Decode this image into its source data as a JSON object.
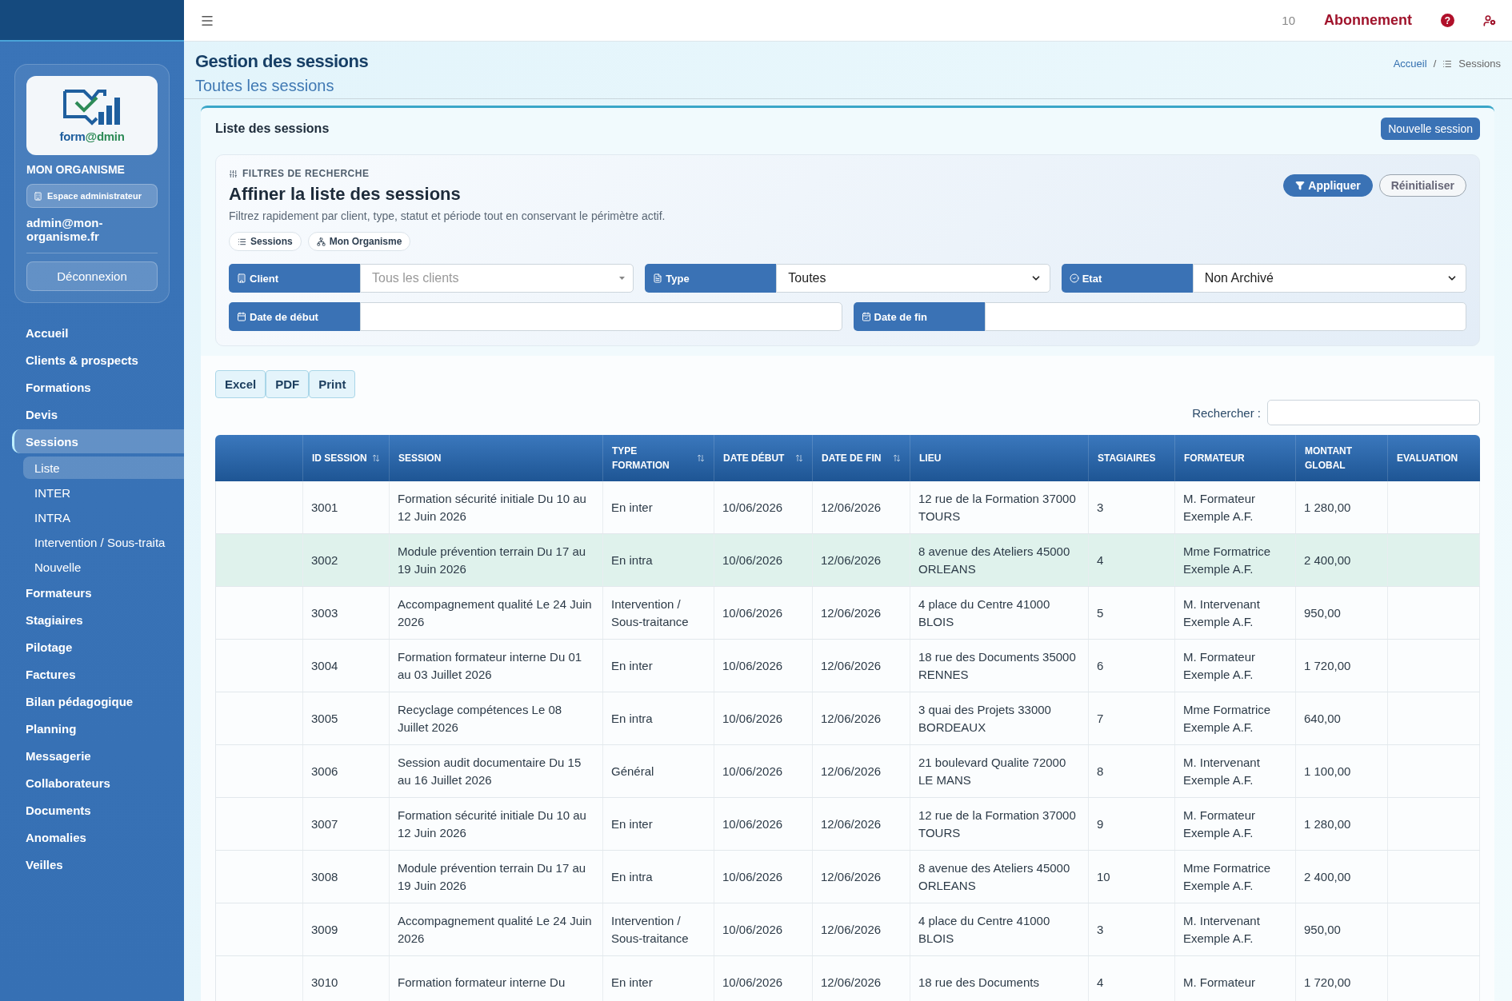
{
  "topbar": {
    "counter": "10",
    "subscription": "Abonnement",
    "help": "?"
  },
  "sidebar": {
    "logo_text": [
      "form",
      "@dmin"
    ],
    "org": "MON ORGANISME",
    "space": "Espace administrateur",
    "email": "admin@mon-organisme.fr",
    "logout": "Déconnexion",
    "nav": [
      {
        "label": "Accueil",
        "selected": false
      },
      {
        "label": "Clients & prospects",
        "selected": false
      },
      {
        "label": "Formations",
        "selected": false
      },
      {
        "label": "Devis",
        "selected": false
      },
      {
        "label": "Sessions",
        "selected": true,
        "children": [
          {
            "label": "Liste",
            "selected": true
          },
          {
            "label": "INTER",
            "selected": false
          },
          {
            "label": "INTRA",
            "selected": false
          },
          {
            "label": "Intervention / Sous-traita",
            "selected": false
          },
          {
            "label": "Nouvelle",
            "selected": false
          }
        ]
      },
      {
        "label": "Formateurs",
        "selected": false
      },
      {
        "label": "Stagiaires",
        "selected": false
      },
      {
        "label": "Pilotage",
        "selected": false
      },
      {
        "label": "Factures",
        "selected": false
      },
      {
        "label": "Bilan pédagogique",
        "selected": false
      },
      {
        "label": "Planning",
        "selected": false
      },
      {
        "label": "Messagerie",
        "selected": false
      },
      {
        "label": "Collaborateurs",
        "selected": false
      },
      {
        "label": "Documents",
        "selected": false
      },
      {
        "label": "Anomalies",
        "selected": false
      },
      {
        "label": "Veilles",
        "selected": false
      }
    ]
  },
  "header": {
    "title": "Gestion des sessions",
    "subtitle": "Toutes les sessions",
    "breadcrumb": [
      "Accueil",
      "Sessions"
    ],
    "breadcrumb_separator": "/"
  },
  "card": {
    "title": "Liste des sessions",
    "new_button": "Nouvelle session"
  },
  "filters": {
    "eyebrow": "FILTRES DE RECHERCHE",
    "heading": "Affiner la liste des sessions",
    "description": "Filtrez rapidement par client, type, statut et période tout en conservant le périmètre actif.",
    "chips": [
      {
        "kind": "list",
        "label": "Sessions"
      },
      {
        "kind": "org",
        "label": "Mon Organisme"
      }
    ],
    "apply": "Appliquer",
    "reset": "Réinitialiser",
    "fields": [
      {
        "kind": "combo",
        "label": "Client",
        "placeholder": "Tous les clients"
      },
      {
        "kind": "select",
        "label": "Type",
        "value": "Toutes"
      },
      {
        "kind": "select",
        "label": "Etat",
        "value": "Non Archivé"
      },
      {
        "kind": "date",
        "label": "Date de début"
      },
      {
        "kind": "date_end",
        "label": "Date de fin"
      }
    ]
  },
  "exports": [
    "Excel",
    "PDF",
    "Print"
  ],
  "search_label": "Rechercher :",
  "table": {
    "columns": [
      {
        "label": "ID SESSION",
        "sortable": true
      },
      {
        "label": "SESSION",
        "sortable": false
      },
      {
        "label": "TYPE FORMATION",
        "sortable": true
      },
      {
        "label": "DATE DÉBUT",
        "sortable": true
      },
      {
        "label": "DATE DE FIN",
        "sortable": true
      },
      {
        "label": "LIEU",
        "sortable": false
      },
      {
        "label": "STAGIAIRES",
        "sortable": false
      },
      {
        "label": "FORMATEUR",
        "sortable": false
      },
      {
        "label": "MONTANT GLOBAL",
        "sortable": false
      },
      {
        "label": "EVALUATION",
        "sortable": false
      }
    ],
    "rows": [
      {
        "highlighted": false,
        "cells": [
          "3001",
          "Formation sécurité initiale Du 10 au 12 Juin 2026",
          "En inter",
          "10/06/2026",
          "12/06/2026",
          "12 rue de la Formation 37000 TOURS",
          "3",
          "M. Formateur Exemple A.F.",
          "1 280,00"
        ]
      },
      {
        "highlighted": true,
        "cells": [
          "3002",
          "Module prévention terrain Du 17 au 19 Juin 2026",
          "En intra",
          "10/06/2026",
          "12/06/2026",
          "8 avenue des Ateliers 45000 ORLEANS",
          "4",
          "Mme Formatrice Exemple A.F.",
          "2 400,00"
        ]
      },
      {
        "highlighted": false,
        "cells": [
          "3003",
          "Accompagnement qualité Le 24 Juin 2026",
          "Intervention / Sous-traitance",
          "10/06/2026",
          "12/06/2026",
          "4 place du Centre 41000 BLOIS",
          "5",
          "M. Intervenant Exemple A.F.",
          "950,00"
        ]
      },
      {
        "highlighted": false,
        "cells": [
          "3004",
          "Formation formateur interne Du 01 au 03 Juillet 2026",
          "En inter",
          "10/06/2026",
          "12/06/2026",
          "18 rue des Documents 35000 RENNES",
          "6",
          "M. Formateur Exemple A.F.",
          "1 720,00"
        ]
      },
      {
        "highlighted": false,
        "cells": [
          "3005",
          "Recyclage compétences Le 08 Juillet 2026",
          "En intra",
          "10/06/2026",
          "12/06/2026",
          "3 quai des Projets 33000 BORDEAUX",
          "7",
          "Mme Formatrice Exemple A.F.",
          "640,00"
        ]
      },
      {
        "highlighted": false,
        "cells": [
          "3006",
          "Session audit documentaire Du 15 au 16 Juillet 2026",
          "Général",
          "10/06/2026",
          "12/06/2026",
          "21 boulevard Qualite 72000 LE MANS",
          "8",
          "M. Intervenant Exemple A.F.",
          "1 100,00"
        ]
      },
      {
        "highlighted": false,
        "cells": [
          "3007",
          "Formation sécurité initiale Du 10 au 12 Juin 2026",
          "En inter",
          "10/06/2026",
          "12/06/2026",
          "12 rue de la Formation 37000 TOURS",
          "9",
          "M. Formateur Exemple A.F.",
          "1 280,00"
        ]
      },
      {
        "highlighted": false,
        "cells": [
          "3008",
          "Module prévention terrain Du 17 au 19 Juin 2026",
          "En intra",
          "10/06/2026",
          "12/06/2026",
          "8 avenue des Ateliers 45000 ORLEANS",
          "10",
          "Mme Formatrice Exemple A.F.",
          "2 400,00"
        ]
      },
      {
        "highlighted": false,
        "cells": [
          "3009",
          "Accompagnement qualité Le 24 Juin 2026",
          "Intervention / Sous-traitance",
          "10/06/2026",
          "12/06/2026",
          "4 place du Centre 41000 BLOIS",
          "3",
          "M. Intervenant Exemple A.F.",
          "950,00"
        ]
      },
      {
        "highlighted": false,
        "cells": [
          "3010",
          "Formation formateur interne Du",
          "En inter",
          "10/06/2026",
          "12/06/2026",
          "18 rue des Documents",
          "4",
          "M. Formateur",
          "1 720,00"
        ]
      }
    ]
  }
}
